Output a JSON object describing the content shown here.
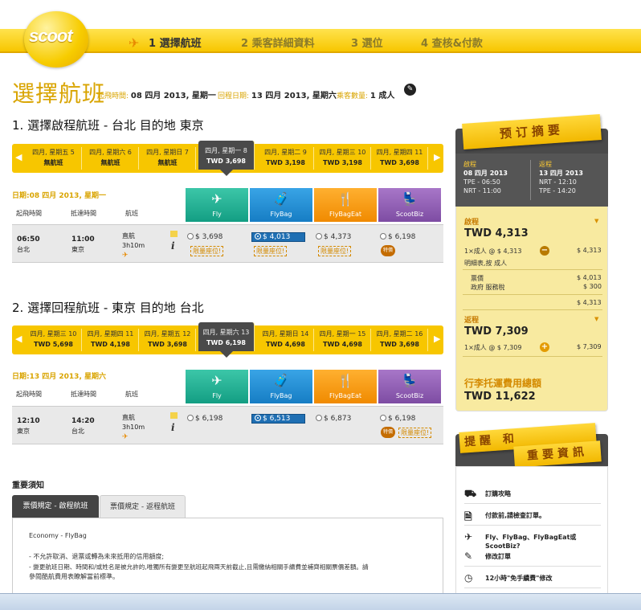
{
  "brand": {
    "logo_text": "scoot",
    "accent": "#f7c600",
    "title_color": "#d9a400"
  },
  "steps": [
    {
      "num": "1",
      "label": "選擇航班"
    },
    {
      "num": "2",
      "label": "乘客詳細資料"
    },
    {
      "num": "3",
      "label": "選位"
    },
    {
      "num": "4",
      "label": "查核&付款"
    }
  ],
  "page": {
    "title": "選擇航班",
    "depart_label": "起飛時間:",
    "depart_value": "08 四月 2013, 星期一",
    "return_label": "回程日期:",
    "return_value": "13 四月 2013, 星期六",
    "pax_label": "乘客數量:",
    "pax_value": "1 成人"
  },
  "outbound": {
    "heading": "1. 選擇啟程航班 - 台北 目的地 東京",
    "dates": [
      {
        "day": "四月, 星期五 5",
        "price": "無航班"
      },
      {
        "day": "四月, 星期六 6",
        "price": "無航班"
      },
      {
        "day": "四月, 星期日 7",
        "price": "無航班"
      },
      {
        "day": "四月, 星期一 8",
        "price": "TWD 3,698"
      },
      {
        "day": "四月, 星期二 9",
        "price": "TWD 3,198"
      },
      {
        "day": "四月, 星期三 10",
        "price": "TWD 3,198"
      },
      {
        "day": "四月, 星期四 11",
        "price": "TWD 3,698"
      }
    ],
    "date_label": "日期:08 四月 2013, 星期一",
    "columns": {
      "dep": "起飛時間",
      "arr": "抵達時間",
      "flight": "航班"
    },
    "fares": [
      "Fly",
      "FlyBag",
      "FlyBagEat",
      "ScootBiz"
    ],
    "flight": {
      "dep_time": "06:50",
      "dep_city": "台北",
      "arr_time": "11:00",
      "arr_city": "東京",
      "type": "直航",
      "duration": "3h10m",
      "prices": [
        "$ 3,698",
        "$ 4,013",
        "$ 4,373",
        "$ 6,198"
      ],
      "limited": "限量座位!",
      "sale": "特價"
    }
  },
  "inbound": {
    "heading": "2. 選擇回程航班 - 東京 目的地 台北",
    "dates": [
      {
        "day": "四月, 星期三 10",
        "price": "TWD 5,698"
      },
      {
        "day": "四月, 星期四 11",
        "price": "TWD 4,198"
      },
      {
        "day": "四月, 星期五 12",
        "price": "TWD 3,698"
      },
      {
        "day": "四月, 星期六 13",
        "price": "TWD 6,198"
      },
      {
        "day": "四月, 星期日 14",
        "price": "TWD 4,698"
      },
      {
        "day": "四月, 星期一 15",
        "price": "TWD 4,698"
      },
      {
        "day": "四月, 星期二 16",
        "price": "TWD 3,698"
      }
    ],
    "date_label": "日期:13 四月 2013, 星期六",
    "columns": {
      "dep": "起飛時間",
      "arr": "抵達時間",
      "flight": "航班"
    },
    "fares": [
      "Fly",
      "FlyBag",
      "FlyBagEat",
      "ScootBiz"
    ],
    "flight": {
      "dep_time": "12:10",
      "dep_city": "東京",
      "arr_time": "14:20",
      "arr_city": "台北",
      "type": "直航",
      "duration": "3h10m",
      "prices": [
        "$ 6,198",
        "$ 6,513",
        "$ 6,873",
        "$ 6,198"
      ],
      "limited": "限量座位!",
      "sale": "特價"
    }
  },
  "notice": {
    "title": "重要須知",
    "tabs": [
      "票價規定 - 啟程航班",
      "票價規定 - 返程航班"
    ],
    "class": "Economy - FlyBag",
    "lines": [
      "- 不允許取消、退票或轉為未來抵用的信用額度;",
      "- 變更航班日期、時間和/或姓名是被允許的,唯獨所有變更至航班起飛兩天前截止,且需繳納相關手續費並補齊相關票價差額。請",
      "參閱酷航費用表瞭解當前標準。"
    ]
  },
  "summary": {
    "banner": "预订摘要",
    "out_label": "啟程",
    "out_date": "08 四月 2013",
    "out_dep": "TPE - 06:50",
    "out_arr": "NRT - 11:00",
    "ret_label": "返程",
    "ret_date": "13 四月 2013",
    "ret_dep": "NRT - 12:10",
    "ret_arr": "TPE - 14:20",
    "sec1_label": "啟程",
    "sec1_total": "TWD 4,313",
    "sec1_pax": "1×成人 @ $ 4,313",
    "sec1_pax_amt": "$ 4,313",
    "sec1_note": "明細表,按 成人",
    "fare_label": "票價",
    "fare_amt": "$ 4,013",
    "tax_label": "政府 服務稅",
    "tax_amt": "$ 300",
    "sec1_sub": "$ 4,313",
    "sec2_label": "返程",
    "sec2_total": "TWD 7,309",
    "sec2_pax": "1×成人 @ $ 7,309",
    "sec2_pax_amt": "$ 7,309",
    "grand_label": "行李托運費用總額",
    "grand_total": "TWD 11,622"
  },
  "reminder": {
    "banner1": "提醒 和",
    "banner2": "重要資訊",
    "items": [
      "訂購攻略",
      "付款前,請檢查訂單。",
      "Fly、FlyBag、FlyBagEat或",
      "ScootBiz?",
      "修改訂單",
      "12小時\"免手續費\"修改"
    ]
  }
}
